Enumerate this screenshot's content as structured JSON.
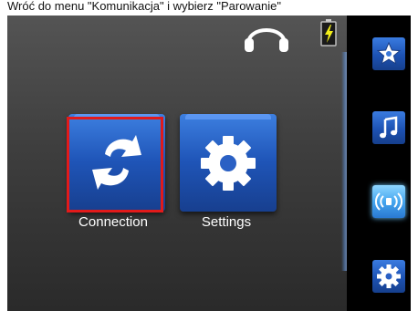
{
  "caption": {
    "text": "Wróć do menu \"Komunikacja\" i wybierz \"Parowanie\""
  },
  "status": {
    "headphones_icon": "headphones-icon",
    "battery_icon": "battery-charging-icon"
  },
  "tiles": [
    {
      "label": "Connection",
      "icon": "sync-arrows-icon",
      "selected": true
    },
    {
      "label": "Settings",
      "icon": "gear-icon",
      "selected": false
    }
  ],
  "sidebar": {
    "items": [
      {
        "icon": "star-icon",
        "active": false
      },
      {
        "icon": "music-note-icon",
        "active": false
      },
      {
        "icon": "wireless-signal-icon",
        "active": true
      },
      {
        "icon": "gear-icon",
        "active": false
      }
    ]
  },
  "colors": {
    "selection": "#e21a1a",
    "tile_blue": "#1f55b8",
    "active_cyan": "#45a6ef"
  }
}
